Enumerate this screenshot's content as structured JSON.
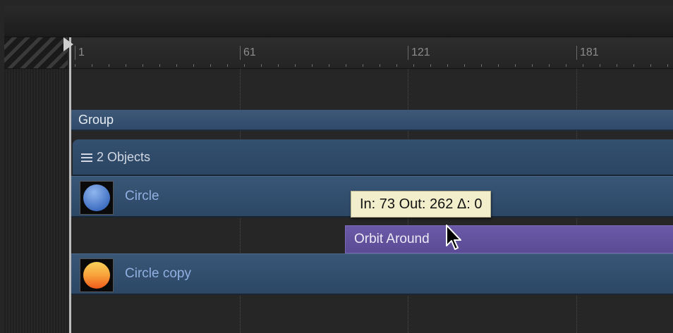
{
  "ruler": {
    "marks": [
      "1",
      "61",
      "121",
      "181"
    ]
  },
  "tracks": {
    "group_label": "Group",
    "objects_label": "2 Objects",
    "layers": [
      {
        "label": "Circle",
        "icon": "blue-circle-icon",
        "colors": [
          "#8fb6ee",
          "#3d6cc0"
        ]
      },
      {
        "label": "Circle copy",
        "icon": "orange-circle-icon",
        "colors": [
          "#f9d25a",
          "#f05a1c"
        ]
      }
    ],
    "behavior_label": "Orbit Around"
  },
  "tooltip": {
    "text": "In: 73 Out: 262 Δ: 0"
  },
  "colors": {
    "group": "#3e5878",
    "behavior": "#6a5aa8",
    "tooltip_bg": "#f2eecb"
  }
}
